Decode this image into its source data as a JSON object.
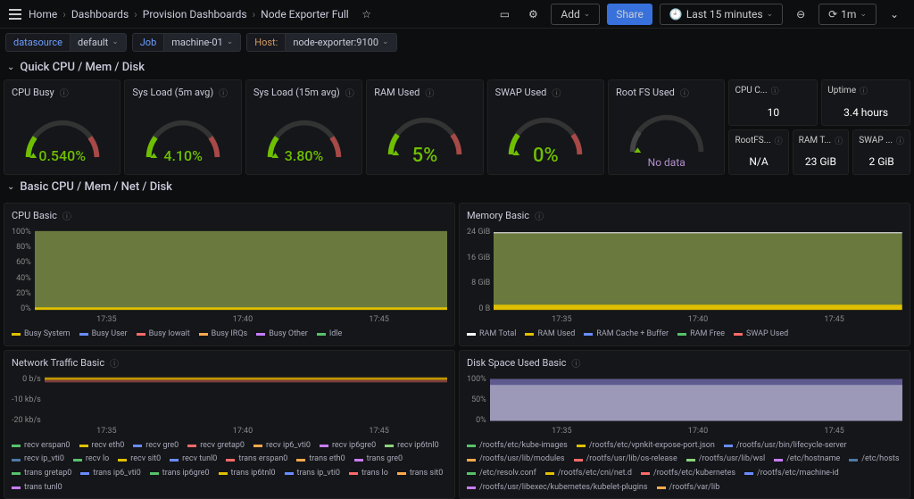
{
  "breadcrumb": [
    "Home",
    "Dashboards",
    "Provision Dashboards",
    "Node Exporter Full"
  ],
  "topbar": {
    "add": "Add",
    "share": "Share",
    "time_range": "Last 15 minutes",
    "refresh": "1m"
  },
  "variables": {
    "datasource_label": "datasource",
    "datasource_value": "default",
    "job_label": "Job",
    "job_value": "machine-01",
    "host_label": "Host:",
    "host_value": "node-exporter:9100"
  },
  "section1": "Quick CPU / Mem / Disk",
  "gauges": [
    {
      "title": "CPU Busy",
      "value": "0.540%"
    },
    {
      "title": "Sys Load (5m avg)",
      "value": "4.10%"
    },
    {
      "title": "Sys Load (15m avg)",
      "value": "3.80%"
    },
    {
      "title": "RAM Used",
      "value": "5%",
      "big": true
    },
    {
      "title": "SWAP Used",
      "value": "0%",
      "big": true
    },
    {
      "title": "Root FS Used",
      "value": "No data",
      "nodata": true
    }
  ],
  "stats": [
    {
      "title": "CPU C...",
      "value": "10"
    },
    {
      "title": "Uptime",
      "value": "3.4 hours"
    },
    {
      "title": "RootFS...",
      "value": "N/A"
    },
    {
      "title": "RAM T...",
      "value": "23 GiB"
    },
    {
      "title": "SWAP ...",
      "value": "2 GiB"
    }
  ],
  "section2": "Basic CPU / Mem / Net / Disk",
  "charts": {
    "cpu": {
      "title": "CPU Basic",
      "yticks": [
        "100%",
        "80%",
        "60%",
        "40%",
        "20%",
        "0%"
      ],
      "xticks": [
        "17:35",
        "17:40",
        "17:45"
      ],
      "legend": [
        [
          "#e0c000",
          "Busy System"
        ],
        [
          "#6a8cff",
          "Busy User"
        ],
        [
          "#ff6a6a",
          "Busy Iowait"
        ],
        [
          "#ffa94d",
          "Busy IRQs"
        ],
        [
          "#c77dff",
          "Busy Other"
        ],
        [
          "#56c26b",
          "Idle"
        ]
      ]
    },
    "mem": {
      "title": "Memory Basic",
      "yticks": [
        "24 GiB",
        "16 GiB",
        "8 GiB",
        "0 B"
      ],
      "xticks": [
        "17:35",
        "17:40",
        "17:45"
      ],
      "legend": [
        [
          "#ffffff",
          "RAM Total"
        ],
        [
          "#e0c000",
          "RAM Used"
        ],
        [
          "#6a8cff",
          "RAM Cache + Buffer"
        ],
        [
          "#56c26b",
          "RAM Free"
        ],
        [
          "#ff6a6a",
          "SWAP Used"
        ]
      ]
    },
    "net": {
      "title": "Network Traffic Basic",
      "yticks": [
        "0 b/s",
        "-10 kb/s",
        "-20 kb/s"
      ],
      "xticks": [
        "17:35",
        "17:40",
        "17:45"
      ],
      "legend": [
        [
          "#56c26b",
          "recv erspan0"
        ],
        [
          "#e0c000",
          "recv eth0"
        ],
        [
          "#6a8cff",
          "recv gre0"
        ],
        [
          "#ff6a6a",
          "recv gretap0"
        ],
        [
          "#ffa94d",
          "recv ip6_vti0"
        ],
        [
          "#c77dff",
          "recv ip6gre0"
        ],
        [
          "#8cd17d",
          "recv ip6tnl0"
        ],
        [
          "#4e79a7",
          "recv ip_vti0"
        ],
        [
          "#56c26b",
          "recv lo"
        ],
        [
          "#e0c000",
          "recv sit0"
        ],
        [
          "#6a8cff",
          "recv tunl0"
        ],
        [
          "#ff6a6a",
          "trans erspan0"
        ],
        [
          "#ffa94d",
          "trans eth0"
        ],
        [
          "#c77dff",
          "trans gre0"
        ],
        [
          "#56c26b",
          "trans gretap0"
        ],
        [
          "#6a8cff",
          "trans ip6_vti0"
        ],
        [
          "#56c26b",
          "trans ip6gre0"
        ],
        [
          "#e0c000",
          "trans ip6tnl0"
        ],
        [
          "#6a8cff",
          "trans ip_vti0"
        ],
        [
          "#ff6a6a",
          "trans lo"
        ],
        [
          "#ffa94d",
          "trans sit0"
        ],
        [
          "#c77dff",
          "trans tunl0"
        ]
      ]
    },
    "disk": {
      "title": "Disk Space Used Basic",
      "yticks": [
        "100%",
        "50%",
        "0%"
      ],
      "xticks": [
        "17:35",
        "17:40",
        "17:45"
      ],
      "legend": [
        [
          "#56c26b",
          "/rootfs/etc/kube-images"
        ],
        [
          "#e0c000",
          "/rootfs/etc/vpnkit-expose-port.json"
        ],
        [
          "#6a8cff",
          "/rootfs/usr/bin/lifecycle-server"
        ],
        [
          "#ffa94d",
          "/rootfs/usr/lib/modules"
        ],
        [
          "#ff6a6a",
          "/rootfs/usr/lib/os-release"
        ],
        [
          "#8cd17d",
          "/rootfs/usr/lib/wsl"
        ],
        [
          "#c77dff",
          "/etc/hostname"
        ],
        [
          "#4e79a7",
          "/etc/hosts"
        ],
        [
          "#56c26b",
          "/etc/resolv.conf"
        ],
        [
          "#e0c000",
          "/rootfs/etc/cni/net.d"
        ],
        [
          "#ff6a6a",
          "/rootfs/etc/kubernetes"
        ],
        [
          "#6a8cff",
          "/rootfs/etc/machine-id"
        ],
        [
          "#c77dff",
          "/rootfs/usr/libexec/kubernetes/kubelet-plugins"
        ],
        [
          "#ffa94d",
          "/rootfs/var/lib"
        ]
      ]
    }
  }
}
